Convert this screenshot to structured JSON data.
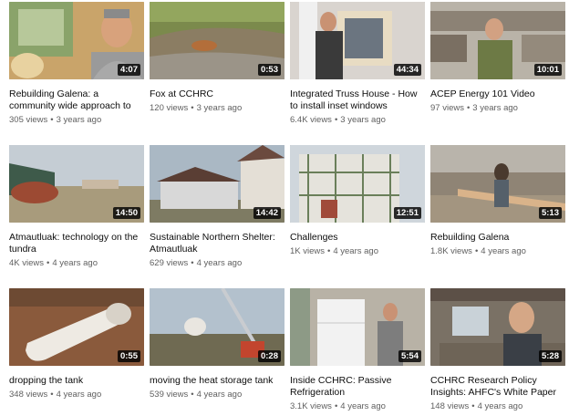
{
  "videos": [
    {
      "title": "Rebuilding Galena: a community wide approach to",
      "views": "305 views",
      "age": "3 years ago",
      "duration": "4:07"
    },
    {
      "title": "Fox at CCHRC",
      "views": "120 views",
      "age": "3 years ago",
      "duration": "0:53"
    },
    {
      "title": "Integrated Truss House - How to install inset windows",
      "views": "6.4K views",
      "age": "3 years ago",
      "duration": "44:34"
    },
    {
      "title": "ACEP Energy 101 Video",
      "views": "97 views",
      "age": "3 years ago",
      "duration": "10:01"
    },
    {
      "title": "Atmautluak: technology on the tundra",
      "views": "4K views",
      "age": "4 years ago",
      "duration": "14:50"
    },
    {
      "title": "Sustainable Northern Shelter: Atmautluak",
      "views": "629 views",
      "age": "4 years ago",
      "duration": "14:42"
    },
    {
      "title": "Challenges",
      "views": "1K views",
      "age": "4 years ago",
      "duration": "12:51"
    },
    {
      "title": "Rebuilding Galena",
      "views": "1.8K views",
      "age": "4 years ago",
      "duration": "5:13"
    },
    {
      "title": "dropping the tank",
      "views": "348 views",
      "age": "4 years ago",
      "duration": "0:55"
    },
    {
      "title": "moving the heat storage tank",
      "views": "539 views",
      "age": "4 years ago",
      "duration": "0:28"
    },
    {
      "title": "Inside CCHRC: Passive Refrigeration",
      "views": "3.1K views",
      "age": "4 years ago",
      "duration": "5:54"
    },
    {
      "title": "CCHRC Research Policy Insights: AHFC's White Paper",
      "views": "148 views",
      "age": "4 years ago",
      "duration": "5:28"
    }
  ]
}
